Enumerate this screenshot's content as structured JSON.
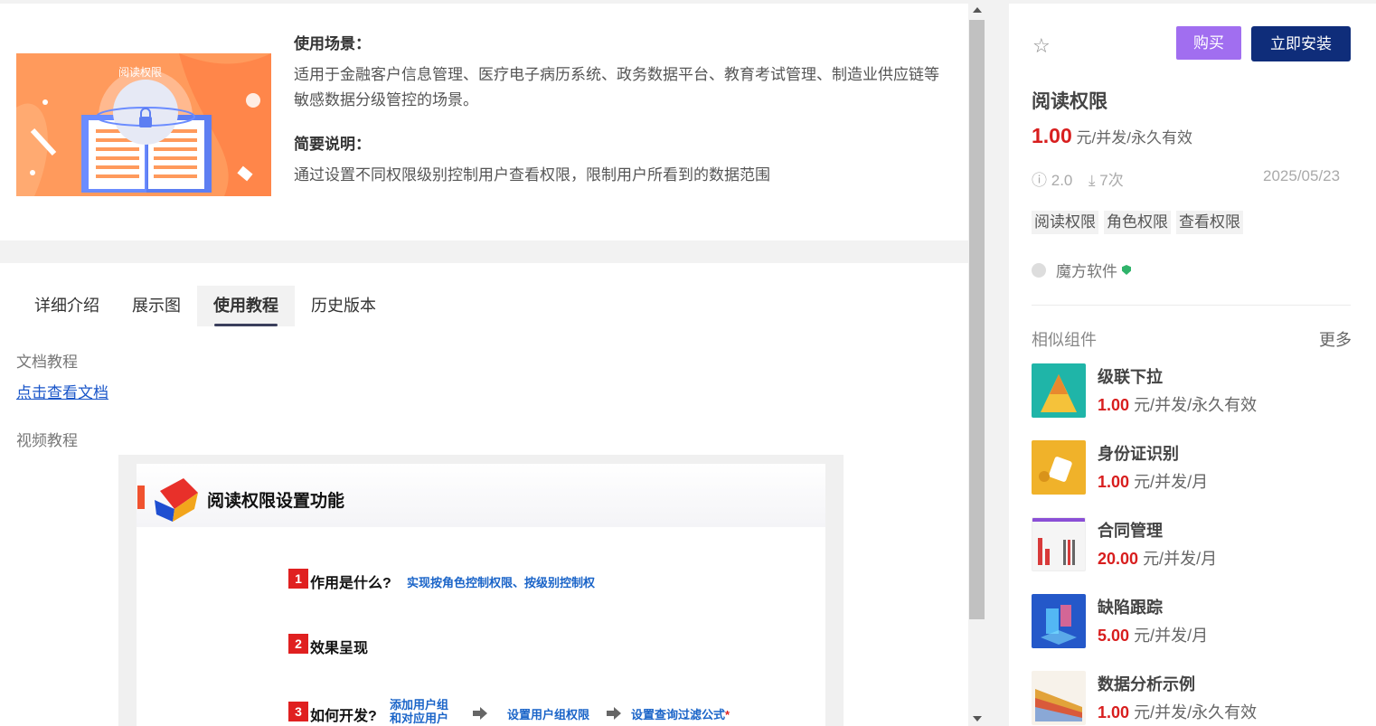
{
  "product": {
    "cover_title": "阅读权限",
    "scenario_heading": "使用场景：",
    "scenario_text": "适用于金融客户信息管理、医疗电子病历系统、政务数据平台、教育考试管理、制造业供应链等敏感数据分级管控的场景。",
    "summary_heading": "简要说明：",
    "summary_text": "通过设置不同权限级别控制用户查看权限，限制用户所看到的数据范围"
  },
  "tabs": [
    {
      "label": "详细介绍",
      "active": false
    },
    {
      "label": "展示图",
      "active": false
    },
    {
      "label": "使用教程",
      "active": true
    },
    {
      "label": "历史版本",
      "active": false
    }
  ],
  "tutorial": {
    "doc_label": "文档教程",
    "doc_link": "点击查看文档",
    "video_label": "视频教程"
  },
  "slide": {
    "title": "阅读权限设置功能",
    "items": [
      {
        "num": "1",
        "question": "作用是什么?",
        "answer": "实现按角色控制权限、按级别控制权"
      },
      {
        "num": "2",
        "question": "效果呈现",
        "answer": ""
      },
      {
        "num": "3",
        "question": "如何开发?",
        "answer": ""
      }
    ],
    "step1_line1": "添加用户组",
    "step1_line2": "和对应用户",
    "step2": "设置用户组权限",
    "step3": "设置查询过滤公式",
    "asterisk": "*"
  },
  "sidebar": {
    "buy_label": "购买",
    "install_label": "立即安装",
    "name": "阅读权限",
    "price": "1.00",
    "price_unit": "元/并发/永久有效",
    "version": "2.0",
    "downloads": "7次",
    "date": "2025/05/23",
    "tags": [
      "阅读权限",
      "角色权限",
      "查看权限"
    ],
    "vendor": "魔方软件",
    "similar_label": "相似组件",
    "more_label": "更多",
    "similar": [
      {
        "name": "级联下拉",
        "price": "1.00",
        "unit": "元/并发/永久有效",
        "color": "#1fb5a8"
      },
      {
        "name": "身份证识别",
        "price": "1.00",
        "unit": "元/并发/月",
        "color": "#f0b22a"
      },
      {
        "name": "合同管理",
        "price": "20.00",
        "unit": "元/并发/月",
        "color": "#f5f5f5"
      },
      {
        "name": "缺陷跟踪",
        "price": "5.00",
        "unit": "元/并发/月",
        "color": "#2458c9"
      },
      {
        "name": "数据分析示例",
        "price": "1.00",
        "unit": "元/并发/永久有效",
        "color": "#f7f2ea"
      }
    ]
  },
  "colors": {
    "accent_price": "#d81e1e",
    "buy_button": "#a16ef0",
    "install_button": "#0f2d7a",
    "cover_bg": "#ff9a5c",
    "link": "#1a56c9"
  }
}
